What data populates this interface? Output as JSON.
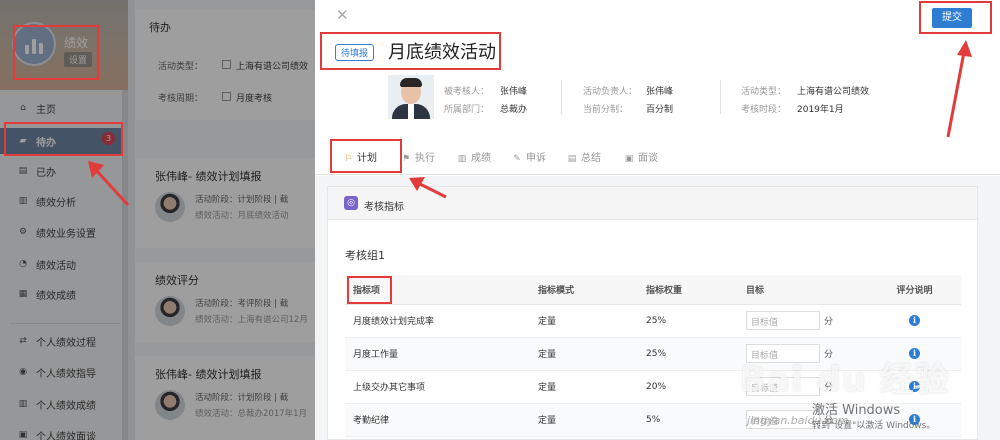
{
  "sidebar": {
    "app_name": "绩效",
    "settings_label": "设置",
    "items": [
      {
        "label": "主页",
        "icon": "home-icon",
        "glyph": "⌂"
      },
      {
        "label": "待办",
        "icon": "tag-icon",
        "glyph": "▰",
        "badge": "3"
      },
      {
        "label": "已办",
        "icon": "done-doc-icon",
        "glyph": "▤"
      },
      {
        "label": "绩效分析",
        "icon": "bar-chart-icon",
        "glyph": "▥"
      },
      {
        "label": "绩效业务设置",
        "icon": "settings-doc-icon",
        "glyph": "⚙"
      },
      {
        "label": "绩效活动",
        "icon": "pie-chart-icon",
        "glyph": "◔"
      },
      {
        "label": "绩效成绩",
        "icon": "list-doc-icon",
        "glyph": "▦"
      },
      {
        "label": "个人绩效过程",
        "icon": "refresh-icon",
        "glyph": "⇄"
      },
      {
        "label": "个人绩效指导",
        "icon": "compass-icon",
        "glyph": "◉"
      },
      {
        "label": "个人绩效成绩",
        "icon": "bar-chart-icon",
        "glyph": "▥"
      },
      {
        "label": "个人绩效面谈",
        "icon": "chat-icon",
        "glyph": "▣"
      }
    ]
  },
  "middle": {
    "title": "待办",
    "filter_type_label": "活动类型：",
    "filter_type_option": "上海有谱公司绩效",
    "filter_period_label": "考核周期：",
    "filter_period_option": "月度考核",
    "cards": [
      {
        "title": "张伟峰- 绩效计划填报",
        "line1": "活动阶段：计划阶段  |  截",
        "line2": "绩效活动：月底绩效活动"
      },
      {
        "title": "绩效评分",
        "line1": "活动阶段：考评阶段  |  截",
        "line2": "绩效活动：上海有谱公司12月"
      },
      {
        "title": "张伟峰- 绩效计划填报",
        "line1": "活动阶段：计划阶段  |  截",
        "line2": "绩效活动：总裁办2017年1月"
      }
    ]
  },
  "panel": {
    "close_glyph": "✕",
    "submit_label": "提交",
    "status_tag": "待填报",
    "title": "月底绩效活动",
    "info": {
      "assessee_label": "被考核人：",
      "assessee": "张伟峰",
      "dept_label": "所属部门：",
      "dept": "总裁办",
      "owner_label": "活动负责人：",
      "owner": "张伟峰",
      "scoring_label": "当前分制：",
      "scoring": "百分制",
      "type_label": "活动类型：",
      "type": "上海有谱公司绩效",
      "period_label": "考核时段：",
      "period": "2019年1月"
    },
    "tabs": [
      {
        "label": "计划",
        "icon": "flag-icon",
        "glyph": "⚐"
      },
      {
        "label": "执行",
        "icon": "execute-icon",
        "glyph": "⚑"
      },
      {
        "label": "成绩",
        "icon": "score-chart-icon",
        "glyph": "▥"
      },
      {
        "label": "申诉",
        "icon": "edit-icon",
        "glyph": "✎"
      },
      {
        "label": "总结",
        "icon": "summary-icon",
        "glyph": "▤"
      },
      {
        "label": "面谈",
        "icon": "chat-icon",
        "glyph": "▣"
      }
    ],
    "section_title": "考核指标",
    "group_title": "考核组1",
    "table": {
      "headers": [
        "指标项",
        "指标模式",
        "指标权重",
        "目标",
        "评分说明"
      ],
      "rows": [
        {
          "item": "月度绩效计划完成率",
          "mode": "定量",
          "weight": "25%",
          "target_placeholder": "目标值",
          "unit": "分"
        },
        {
          "item": "月度工作量",
          "mode": "定量",
          "weight": "25%",
          "target_placeholder": "目标值",
          "unit": "分"
        },
        {
          "item": "上级交办其它事项",
          "mode": "定量",
          "weight": "20%",
          "target_placeholder": "目标值",
          "unit": "分"
        },
        {
          "item": "考勤纪律",
          "mode": "定量",
          "weight": "5%",
          "target_placeholder": "目标值",
          "unit": "分"
        }
      ]
    }
  },
  "watermark": {
    "baidu": "Bai du 经验",
    "jingyan": "jingyan.baidu.com",
    "activate": "激活 Windows",
    "activate_hint": "转到\"设置\"以激活 Windows。"
  },
  "colors": {
    "accent": "#2f7cd3",
    "annotation": "#e23b3b",
    "badge": "#e04555",
    "active_nav": "#6f86a4"
  }
}
